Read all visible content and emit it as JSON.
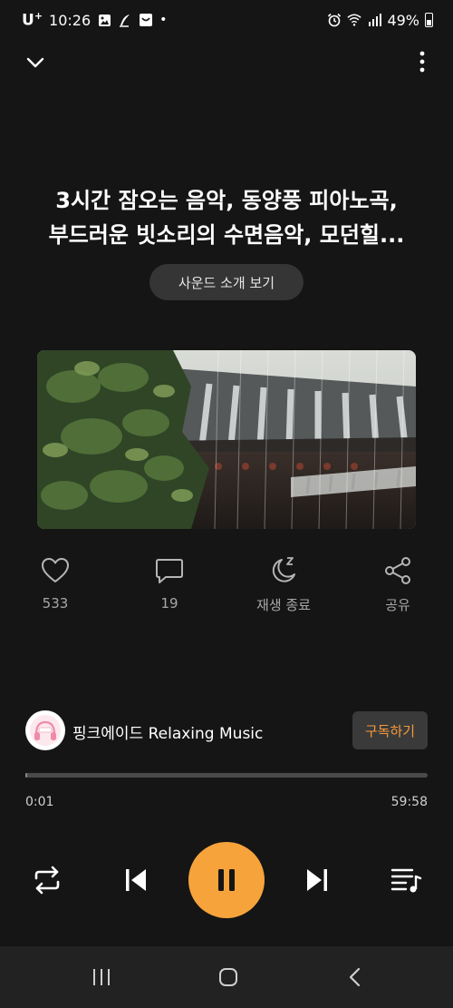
{
  "status_bar": {
    "carrier": "U",
    "carrier_sup": "+",
    "time": "10:26",
    "dot": "•",
    "battery": "49%"
  },
  "track": {
    "title_line1": "3시간 잠오는 음악, 동양풍 피아노곡,",
    "title_line2": "부드러운 빗소리의 수면음악, 모던힐..."
  },
  "intro_button_label": "사운드 소개 보기",
  "actions": {
    "like_count": "533",
    "comment_count": "19",
    "sleep_timer_label": "재생 종료",
    "share_label": "공유"
  },
  "channel": {
    "name": "핑크에이드 Relaxing Music",
    "subscribe_label": "구독하기"
  },
  "playback": {
    "current_time": "0:01",
    "total_time": "59:58",
    "progress": 0.0003
  },
  "colors": {
    "accent": "#f7a33c",
    "subscribe_text": "#f49a3b",
    "background": "#151515"
  }
}
